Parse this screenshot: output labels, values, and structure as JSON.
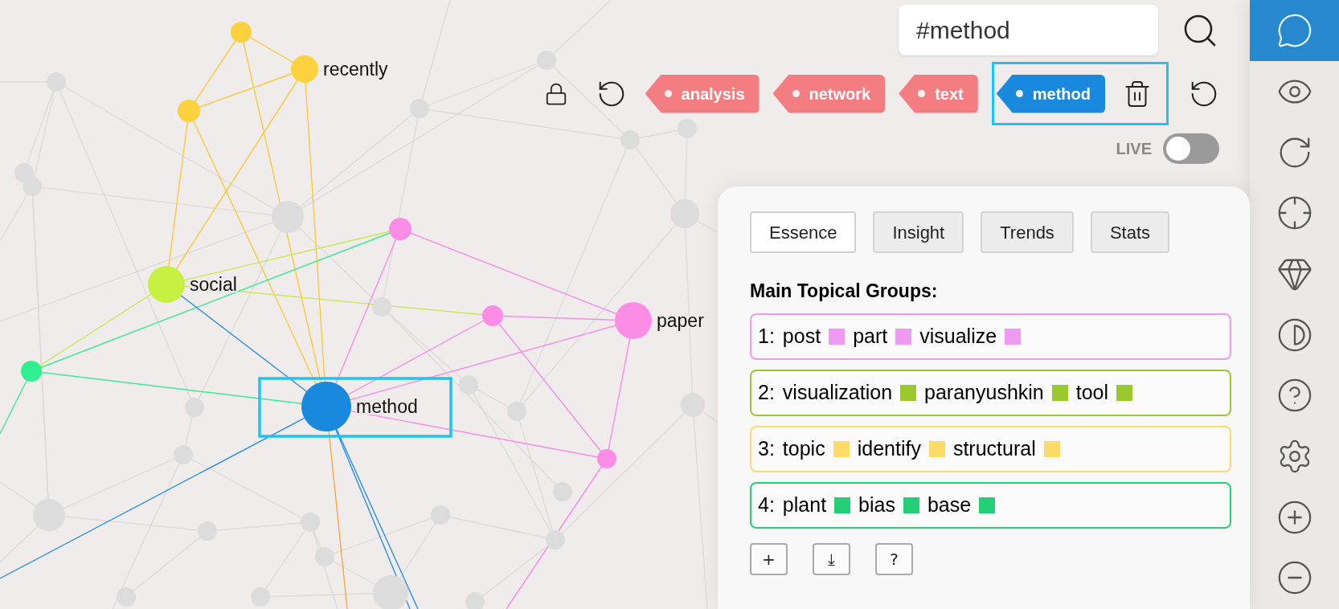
{
  "graph": {
    "nodes": [
      {
        "label": "recently",
        "color": "#fdd03e",
        "selected": false
      },
      {
        "label": "social",
        "color": "#c6f042",
        "selected": false
      },
      {
        "label": "paper",
        "color": "#fb8de6",
        "selected": false
      },
      {
        "label": "method",
        "color": "#1889dd",
        "selected": true
      }
    ]
  },
  "search": {
    "value": "#method"
  },
  "tags": [
    {
      "label": "analysis",
      "selected": false
    },
    {
      "label": "network",
      "selected": false
    },
    {
      "label": "text",
      "selected": false
    },
    {
      "label": "method",
      "selected": true
    }
  ],
  "live": {
    "label": "LIVE",
    "on": false
  },
  "panel": {
    "tabs": [
      {
        "label": "Essence",
        "selected": true
      },
      {
        "label": "Insight",
        "selected": false
      },
      {
        "label": "Trends",
        "selected": false
      },
      {
        "label": "Stats",
        "selected": false
      }
    ],
    "heading": "Main Topical Groups:",
    "groups": [
      {
        "number": "1:",
        "color": "#ef9af2",
        "terms": [
          "post",
          "part",
          "visualize"
        ]
      },
      {
        "number": "2:",
        "color": "#9bc82c",
        "terms": [
          "visualization",
          "paranyushkin",
          "tool"
        ]
      },
      {
        "number": "3:",
        "color": "#fddb66",
        "terms": [
          "topic",
          "identify",
          "structural"
        ]
      },
      {
        "number": "4:",
        "color": "#25cf78",
        "terms": [
          "plant",
          "bias",
          "base"
        ]
      }
    ],
    "buttons": [
      "+",
      "⤓",
      "?"
    ]
  },
  "sidebar": {
    "items": [
      {
        "selected": true
      },
      {
        "selected": false
      },
      {
        "selected": false
      },
      {
        "selected": false
      },
      {
        "selected": false
      },
      {
        "selected": false
      },
      {
        "selected": false
      },
      {
        "selected": false
      },
      {
        "selected": false
      },
      {
        "selected": false
      }
    ]
  }
}
